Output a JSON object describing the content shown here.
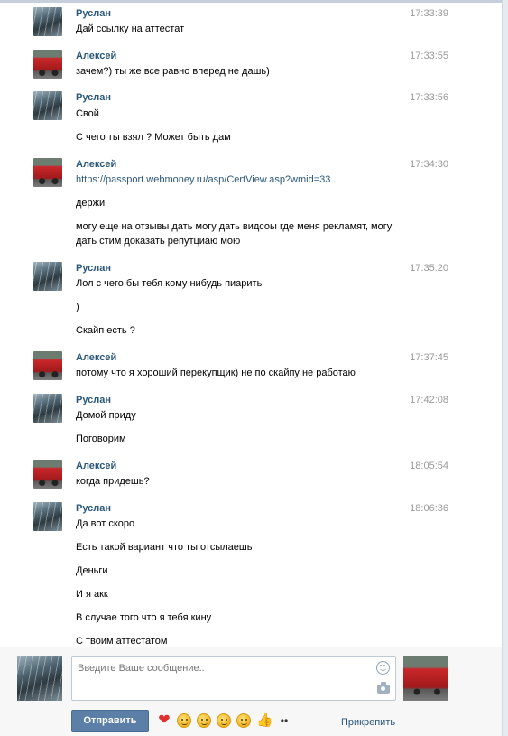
{
  "colors": {
    "accent": "#2b587a",
    "send_button": "#5b7fa6",
    "time_text": "#999999",
    "border": "#c0cad5"
  },
  "messages": [
    {
      "author": "Руслан",
      "avatar": "ruslan",
      "time": "17:33:39",
      "lines": [
        "Дай ссылку на аттестат"
      ]
    },
    {
      "author": "Алексей",
      "avatar": "aleksey",
      "time": "17:33:55",
      "lines": [
        "зачем?) ты же все равно вперед не дашь)"
      ]
    },
    {
      "author": "Руслан",
      "avatar": "ruslan",
      "time": "17:33:56",
      "lines": [
        "Свой",
        "С чего ты взял ? Может быть дам"
      ]
    },
    {
      "author": "Алексей",
      "avatar": "aleksey",
      "time": "17:34:30",
      "lines": [
        "https://passport.webmoney.ru/asp/CertView.asp?wmid=33..",
        "держи",
        "могу еще на отзывы дать могу дать видсоы где меня рекламят, могу",
        "дать стим доказать репутциаю мою"
      ]
    },
    {
      "author": "Руслан",
      "avatar": "ruslan",
      "time": "17:35:20",
      "lines": [
        "Лол с чего бы тебя кому нибудь пиарить",
        ")",
        "Скайп есть ?"
      ]
    },
    {
      "author": "Алексей",
      "avatar": "aleksey",
      "time": "17:37:45",
      "lines": [
        "потому что я хороший перекупщик) не по скайпу не работаю"
      ]
    },
    {
      "author": "Руслан",
      "avatar": "ruslan",
      "time": "17:42:08",
      "lines": [
        "Домой приду",
        "Поговорим"
      ]
    },
    {
      "author": "Алексей",
      "avatar": "aleksey",
      "time": "18:05:54",
      "lines": [
        "когда придешь?"
      ]
    },
    {
      "author": "Руслан",
      "avatar": "ruslan",
      "time": "18:06:36",
      "lines": [
        "Да вот скоро",
        "Есть такой вариант что ты отсылаешь",
        "Деньги",
        "И я акк",
        "В случае того что я тебя кину",
        "С твоим аттестатом"
      ]
    }
  ],
  "composer": {
    "placeholder": "Введите Ваше сообщение..",
    "send_label": "Отправить",
    "attach_label": "Прикрепить",
    "smile_icon": "smile-icon",
    "camera_icon": "camera-icon",
    "emojis": [
      "heart-icon",
      "emoji-face-icon",
      "emoji-face-icon",
      "emoji-face-icon",
      "emoji-face-icon",
      "thumbs-up-icon",
      "eyes-icon"
    ]
  }
}
